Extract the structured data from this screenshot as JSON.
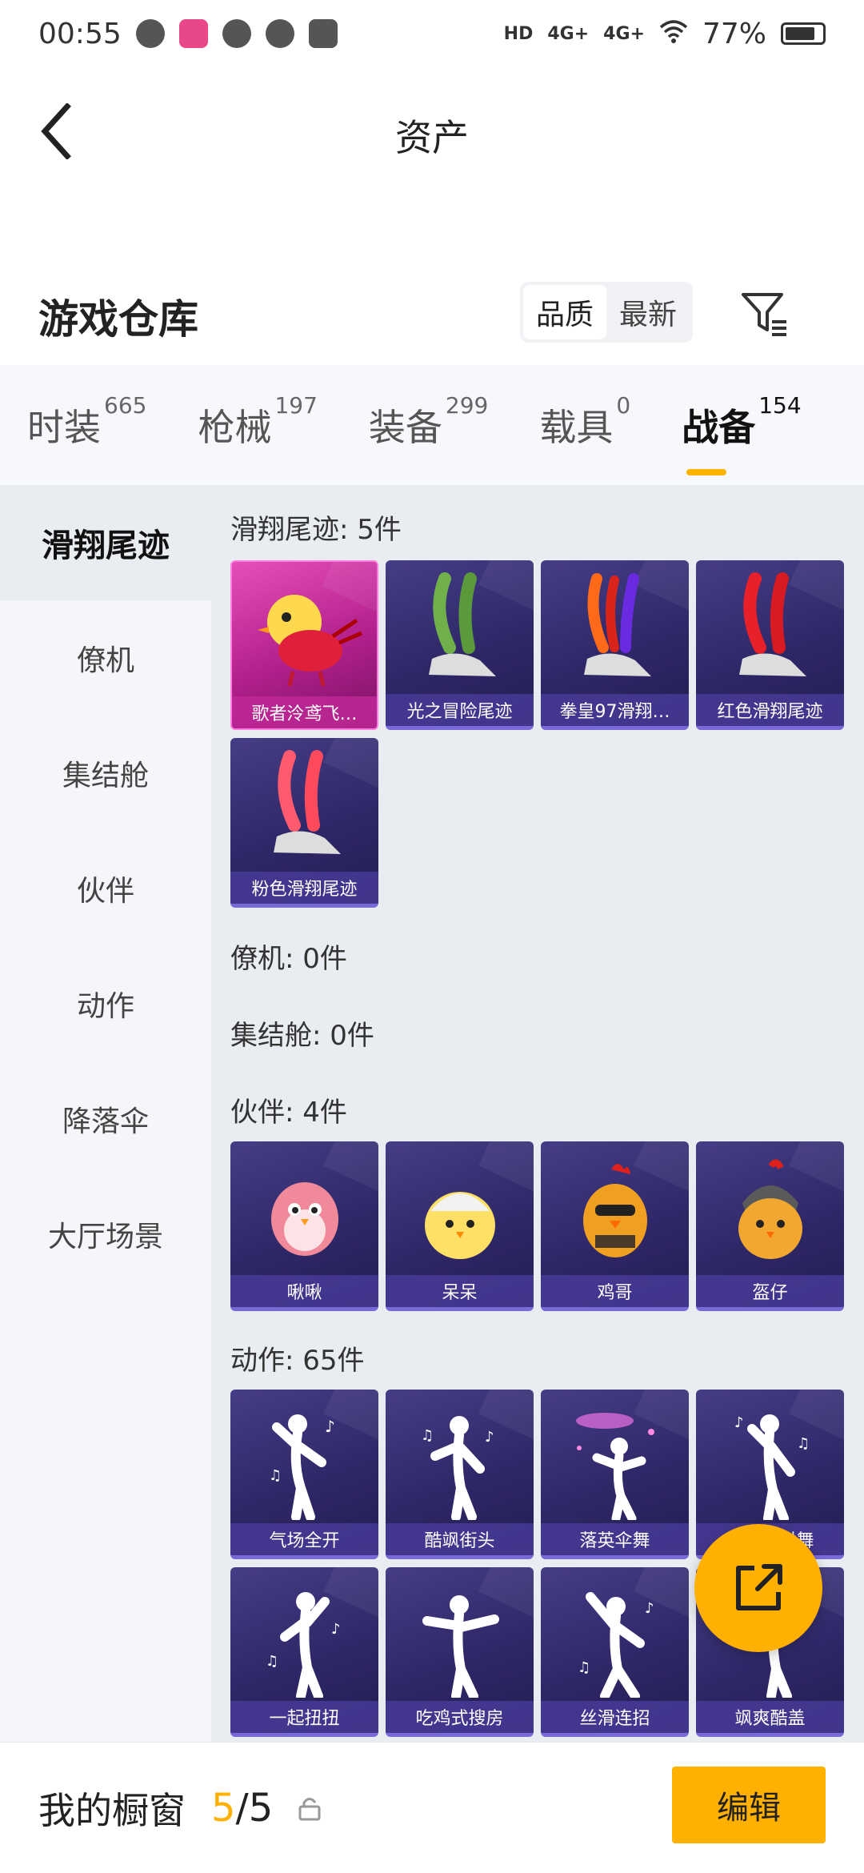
{
  "status_bar": {
    "time": "00:55",
    "battery": "77%",
    "network_1": "4G+",
    "network_2": "4G+",
    "hd": "HD"
  },
  "header": {
    "title": "资产"
  },
  "warehouse": {
    "title": "游戏仓库",
    "sort_options": [
      "品质",
      "最新"
    ],
    "active_sort": "品质"
  },
  "tabs": [
    {
      "label": "时装",
      "count": "665"
    },
    {
      "label": "枪械",
      "count": "197"
    },
    {
      "label": "装备",
      "count": "299"
    },
    {
      "label": "载具",
      "count": "0"
    },
    {
      "label": "战备",
      "count": "154"
    }
  ],
  "active_tab": "战备",
  "sidebar": {
    "items": [
      "滑翔尾迹",
      "僚机",
      "集结舱",
      "伙伴",
      "动作",
      "降落伞",
      "大厅场景"
    ],
    "active": "滑翔尾迹"
  },
  "sections": {
    "glide": {
      "title": "滑翔尾迹: 5件",
      "items": [
        "歌者泠鸢飞…",
        "光之冒险尾迹",
        "拳皇97滑翔…",
        "红色滑翔尾迹",
        "粉色滑翔尾迹"
      ]
    },
    "wingman": {
      "title": "僚机: 0件"
    },
    "capsule": {
      "title": "集结舱: 0件"
    },
    "partner": {
      "title": "伙伴: 4件",
      "items": [
        "啾啾",
        "呆呆",
        "鸡哥",
        "盔仔"
      ]
    },
    "action": {
      "title": "动作: 65件",
      "items": [
        "气场全开",
        "酷飒街头",
        "落英伞舞",
        "魅力四射舞",
        "一起扭扭",
        "吃鸡式搜房",
        "丝滑连招",
        "飒爽酷盖"
      ]
    }
  },
  "bottom": {
    "label": "我的橱窗",
    "current": "5",
    "separator": "/",
    "total": "5",
    "edit_label": "编辑"
  },
  "colors": {
    "accent": "#ffb000",
    "card_bg": "#2f2868",
    "card_highlight": "#b2208c"
  }
}
